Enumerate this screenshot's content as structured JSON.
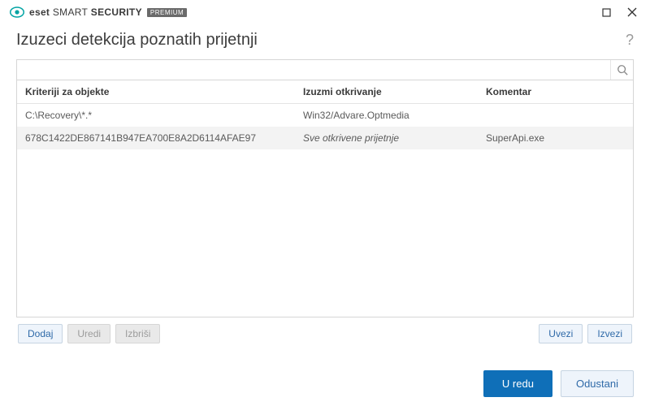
{
  "brand": {
    "name_light": "SMART",
    "name_bold": "SECURITY",
    "badge": "PREMIUM",
    "company": "eset"
  },
  "header": {
    "title": "Izuzeci detekcija poznatih prijetnji"
  },
  "search": {
    "value": "",
    "placeholder": ""
  },
  "table": {
    "columns": [
      "Kriteriji za objekte",
      "Izuzmi otkrivanje",
      "Komentar"
    ],
    "rows": [
      {
        "criteria": "C:\\Recovery\\*.*",
        "exclude": "Win32/Advare.Optmedia",
        "exclude_italic": false,
        "comment": ""
      },
      {
        "criteria": "678C1422DE867141B947EA700E8A2D6114AFAE97",
        "exclude": "Sve otkrivene prijetnje",
        "exclude_italic": true,
        "comment": "SuperApi.exe"
      }
    ]
  },
  "actions": {
    "add": "Dodaj",
    "edit": "Uredi",
    "delete": "Izbriši",
    "import": "Uvezi",
    "export": "Izvezi"
  },
  "footer": {
    "ok": "U redu",
    "cancel": "Odustani"
  }
}
